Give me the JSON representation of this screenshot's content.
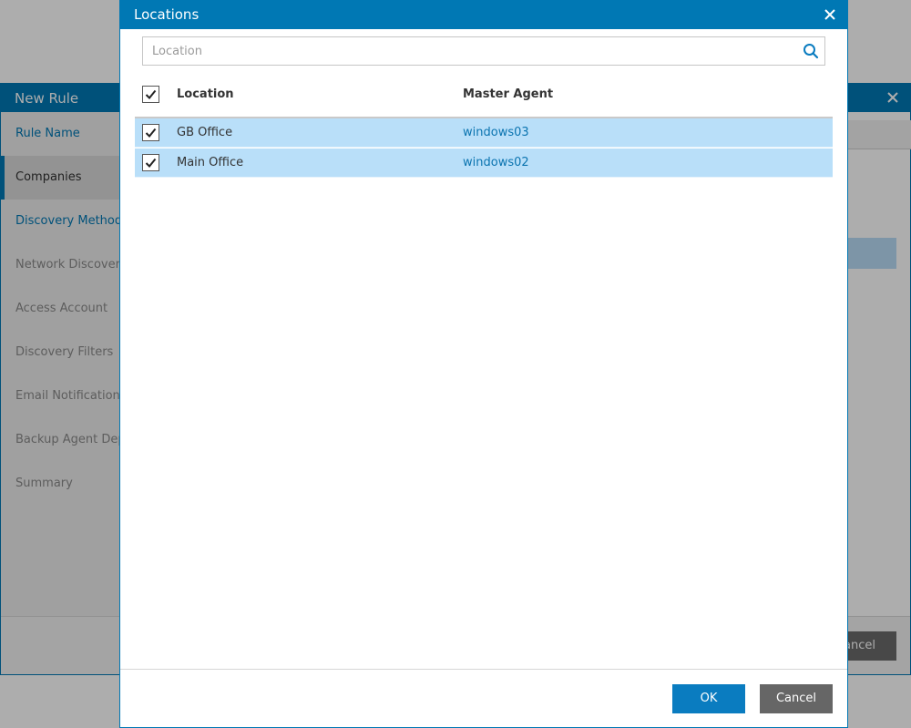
{
  "background_window": {
    "title": "New Rule",
    "nav_items": [
      {
        "label": "Rule Name",
        "state": "done"
      },
      {
        "label": "Companies",
        "state": "current"
      },
      {
        "label": "Discovery Method",
        "state": "done"
      },
      {
        "label": "Network Discovery",
        "state": "pending"
      },
      {
        "label": "Access Account",
        "state": "pending"
      },
      {
        "label": "Discovery Filters",
        "state": "pending"
      },
      {
        "label": "Email Notification",
        "state": "pending"
      },
      {
        "label": "Backup Agent Depl",
        "state": "pending"
      },
      {
        "label": "Summary",
        "state": "pending"
      }
    ],
    "cancel_label_visible": "ancel"
  },
  "dialog": {
    "title": "Locations",
    "search": {
      "placeholder": "Location",
      "value": ""
    },
    "columns": {
      "location": "Location",
      "master_agent": "Master Agent"
    },
    "select_all_checked": true,
    "rows": [
      {
        "location": "GB Office",
        "master_agent": "windows03",
        "checked": true
      },
      {
        "location": "Main Office",
        "master_agent": "windows02",
        "checked": true
      }
    ],
    "buttons": {
      "ok": "OK",
      "cancel": "Cancel"
    }
  },
  "colors": {
    "accent": "#0078b4",
    "row_selected": "#b9dff9",
    "link": "#0b74b0",
    "cancel_button": "#666666"
  },
  "icons": {
    "close": "close-icon",
    "search": "search-icon",
    "check": "checkmark-icon"
  }
}
